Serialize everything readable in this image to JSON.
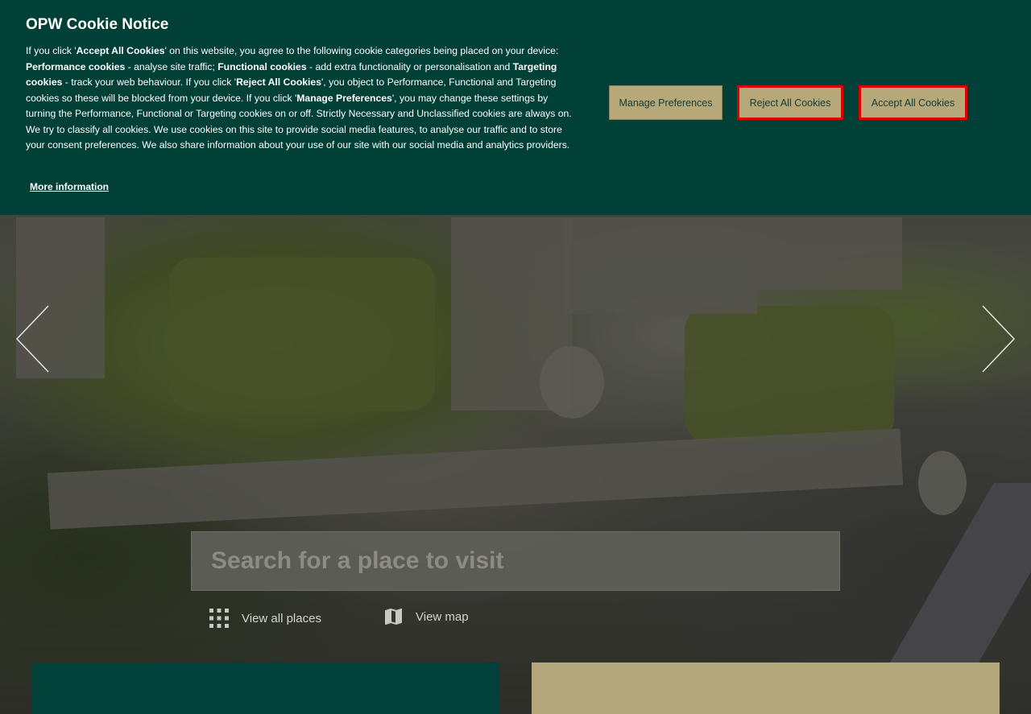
{
  "cookie_banner": {
    "title": "OPW Cookie Notice",
    "p1": "If you click '",
    "b1": "Accept All Cookies",
    "p2": "' on this website, you agree to the following cookie categories being placed on your device: ",
    "b2": "Performance cookies",
    "p3": " - analyse site traffic; ",
    "b3": "Functional cookies",
    "p4": " - add extra functionality or personalisation and ",
    "b4": "Targeting cookies",
    "p5": " - track your web behaviour. If you click '",
    "b5": "Reject All Cookies",
    "p6": "', you object to Performance, Functional and Targeting cookies so these will be blocked from your device. If you click '",
    "b6": "Manage Preferences",
    "p7": "', you may change these settings by turning the Performance, Functional or Targeting cookies on or off. Strictly Necessary and Unclassified cookies are always on. We try to classify all cookies. We use cookies on this site to provide social media features, to analyse our traffic and to store your consent preferences. We also share information about your use of our site with our social media and analytics providers.",
    "more_info": "More information",
    "buttons": {
      "manage": "Manage Preferences",
      "reject": "Reject All Cookies",
      "accept": "Accept All Cookies"
    },
    "colors": {
      "background": "#004037",
      "button": "#b6a878",
      "focus_outline": "#e00000"
    }
  },
  "hero": {
    "search_placeholder": "Search for a place to visit",
    "links": {
      "all_places": "View all places",
      "map": "View map"
    },
    "icons": {
      "prev": "chevron-left-icon",
      "next": "chevron-right-icon",
      "grid": "grid-icon",
      "map": "map-icon"
    }
  },
  "cards": {
    "colors": {
      "left": "#00423a",
      "right": "#b3a67a"
    }
  }
}
